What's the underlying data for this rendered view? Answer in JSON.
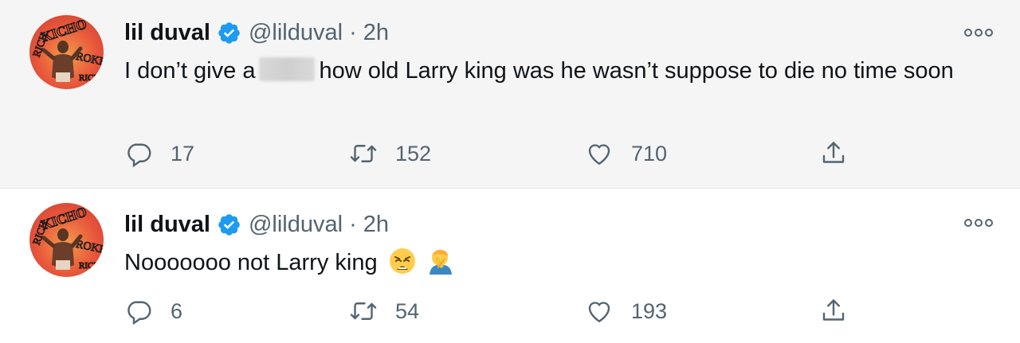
{
  "tweets": [
    {
      "author_name": "lil duval",
      "handle": "@lilduval",
      "separator": "·",
      "time": "2h",
      "text_before": "I don’t give a",
      "text_after": "how old Larry king was he wasn’t suppose to die no time soon",
      "replies": "17",
      "retweets": "152",
      "likes": "710"
    },
    {
      "author_name": "lil duval",
      "handle": "@lilduval",
      "separator": "·",
      "time": "2h",
      "text": "Nooooooo not Larry king",
      "emojis": [
        "weary-face",
        "man-facepalming"
      ],
      "replies": "6",
      "retweets": "54",
      "likes": "193"
    }
  ],
  "icons": {
    "verified_color": "#1d9bf0",
    "action_color": "#536471",
    "avatar_text": [
      "KICHO",
      "RICH",
      "ROKE",
      "RICH"
    ]
  }
}
